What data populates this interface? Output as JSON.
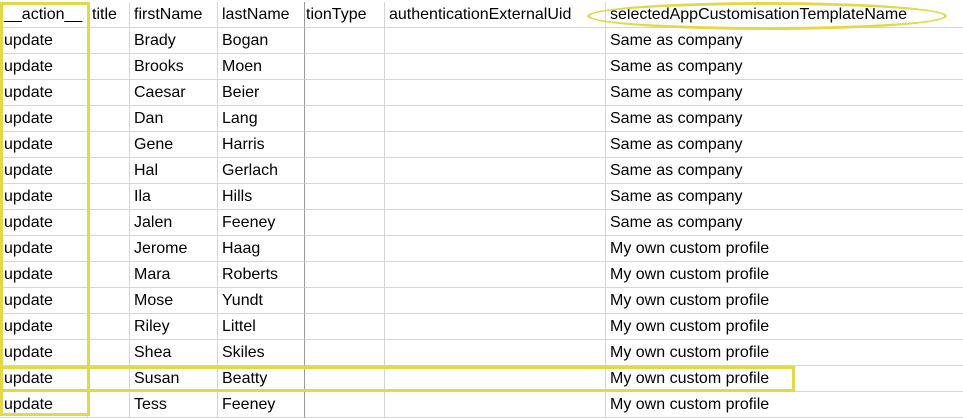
{
  "columns": [
    "__action__",
    "title",
    "firstName",
    "lastName",
    "tionType",
    "authenticationExternalUid",
    "selectedAppCustomisationTemplateName"
  ],
  "rows": [
    [
      "update",
      "",
      "Brady",
      "Bogan",
      "",
      "",
      "Same as company"
    ],
    [
      "update",
      "",
      "Brooks",
      "Moen",
      "",
      "",
      "Same as company"
    ],
    [
      "update",
      "",
      "Caesar",
      "Beier",
      "",
      "",
      "Same as company"
    ],
    [
      "update",
      "",
      "Dan",
      "Lang",
      "",
      "",
      "Same as company"
    ],
    [
      "update",
      "",
      "Gene",
      "Harris",
      "",
      "",
      "Same as company"
    ],
    [
      "update",
      "",
      "Hal",
      "Gerlach",
      "",
      "",
      "Same as company"
    ],
    [
      "update",
      "",
      "Ila",
      "Hills",
      "",
      "",
      "Same as company"
    ],
    [
      "update",
      "",
      "Jalen",
      "Feeney",
      "",
      "",
      "Same as company"
    ],
    [
      "update",
      "",
      "Jerome",
      "Haag",
      "",
      "",
      "My own custom profile"
    ],
    [
      "update",
      "",
      "Mara",
      "Roberts",
      "",
      "",
      "My own custom profile"
    ],
    [
      "update",
      "",
      "Mose",
      "Yundt",
      "",
      "",
      "My own custom profile"
    ],
    [
      "update",
      "",
      "Riley",
      "Littel",
      "",
      "",
      "My own custom profile"
    ],
    [
      "update",
      "",
      "Shea",
      "Skiles",
      "",
      "",
      "My own custom profile"
    ],
    [
      "update",
      "",
      "Susan",
      "Beatty",
      "",
      "",
      "My own custom profile"
    ],
    [
      "update",
      "",
      "Tess",
      "Feeney",
      "",
      "",
      "My own custom profile"
    ]
  ],
  "highlight_color": "#e2d94a",
  "grid_line_color": "#d4d4d4"
}
